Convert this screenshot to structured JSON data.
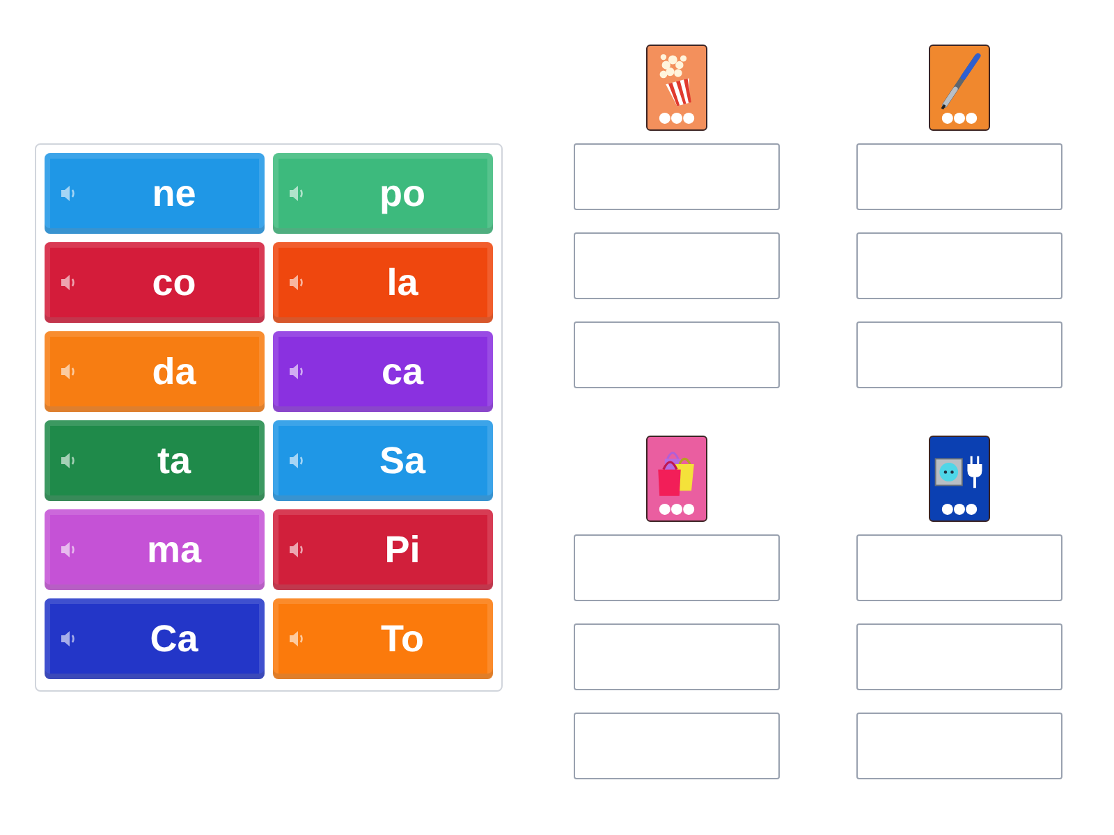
{
  "tiles": [
    {
      "text": "ne",
      "color": "#1f97e6"
    },
    {
      "text": "po",
      "color": "#3dba7d"
    },
    {
      "text": "co",
      "color": "#d41c3a"
    },
    {
      "text": "la",
      "color": "#ef470e"
    },
    {
      "text": "da",
      "color": "#f77d12"
    },
    {
      "text": "ca",
      "color": "#8a31e0"
    },
    {
      "text": "ta",
      "color": "#1f8a4a"
    },
    {
      "text": "Sa",
      "color": "#1f97e6"
    },
    {
      "text": "ma",
      "color": "#c552d6"
    },
    {
      "text": "Pi",
      "color": "#d11f3b"
    },
    {
      "text": "Ca",
      "color": "#2336c8"
    },
    {
      "text": "To",
      "color": "#fb7a0c"
    }
  ],
  "groups": [
    {
      "kind": "popcorn",
      "color": "#f3905c",
      "boxes": [
        {
          "filled": false
        },
        {
          "filled": false
        },
        {
          "filled": false
        }
      ]
    },
    {
      "kind": "pen",
      "color": "#f0882e",
      "boxes": [
        {
          "filled": false
        },
        {
          "filled": false
        },
        {
          "filled": false
        }
      ]
    },
    {
      "kind": "shopping-bags",
      "color": "#ea5ea0",
      "boxes": [
        {
          "filled": false
        },
        {
          "filled": false
        },
        {
          "filled": false
        }
      ]
    },
    {
      "kind": "socket-plug",
      "color": "#0b40b2",
      "boxes": [
        {
          "filled": false
        },
        {
          "filled": false
        },
        {
          "filled": false
        }
      ]
    }
  ]
}
